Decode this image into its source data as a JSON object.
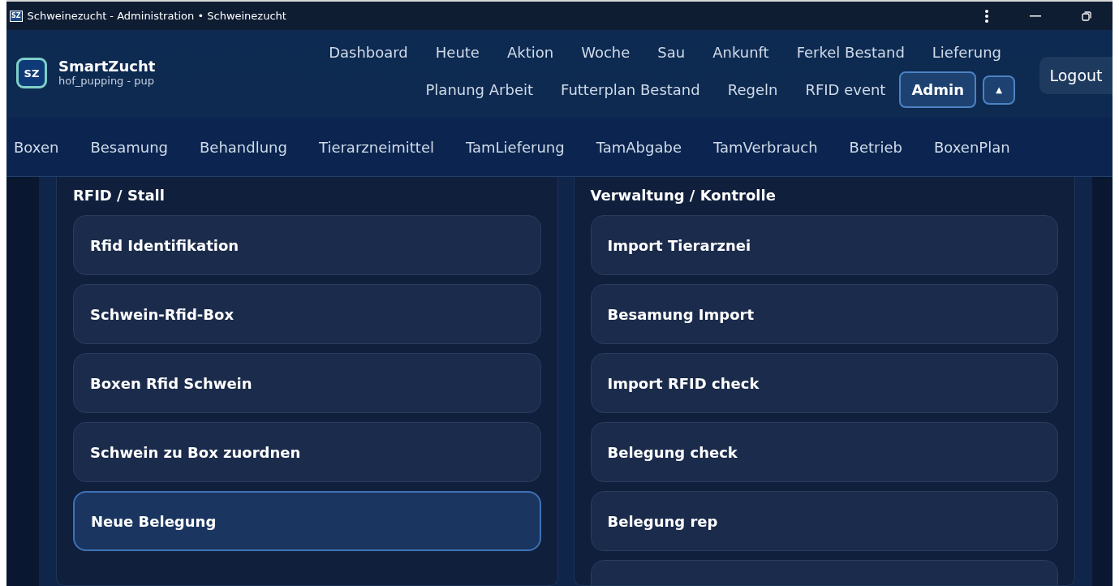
{
  "window": {
    "title": "Schweinezucht - Administration • Schweinezucht",
    "app_icon_text": "SZ"
  },
  "brand": {
    "logo_text": "SZ",
    "name": "SmartZucht",
    "subtitle": "hof_pupping - pup"
  },
  "nav_row_1": [
    {
      "label": "Dashboard",
      "selected": false
    },
    {
      "label": "Heute",
      "selected": false
    },
    {
      "label": "Aktion",
      "selected": false
    },
    {
      "label": "Woche",
      "selected": false
    },
    {
      "label": "Sau",
      "selected": false
    },
    {
      "label": "Ankunft",
      "selected": false
    },
    {
      "label": "Ferkel Bestand",
      "selected": false
    },
    {
      "label": "Lieferung",
      "selected": false
    }
  ],
  "nav_row_2": [
    {
      "label": "Planung Arbeit",
      "selected": false
    },
    {
      "label": "Futterplan Bestand",
      "selected": false
    },
    {
      "label": "Regeln",
      "selected": false
    },
    {
      "label": "RFID event",
      "selected": false
    },
    {
      "label": "Admin",
      "selected": true
    }
  ],
  "collapse_button": "▲",
  "logout": "Logout",
  "subnav": [
    "Boxen",
    "Besamung",
    "Behandlung",
    "Tierarzneimittel",
    "TamLieferung",
    "TamAbgabe",
    "TamVerbrauch",
    "Betrieb",
    "BoxenPlan"
  ],
  "sections": [
    {
      "title": "RFID / Stall",
      "items": [
        {
          "label": "Rfid Identifikation",
          "selected": false
        },
        {
          "label": "Schwein-Rfid-Box",
          "selected": false
        },
        {
          "label": "Boxen Rfid Schwein",
          "selected": false
        },
        {
          "label": "Schwein zu Box zuordnen",
          "selected": false
        },
        {
          "label": "Neue Belegung",
          "selected": true
        }
      ]
    },
    {
      "title": "Verwaltung / Kontrolle",
      "items": [
        {
          "label": "Import Tierarznei",
          "selected": false
        },
        {
          "label": "Besamung Import",
          "selected": false
        },
        {
          "label": "Import RFID check",
          "selected": false
        },
        {
          "label": "Belegung check",
          "selected": false
        },
        {
          "label": "Belegung rep",
          "selected": false
        }
      ]
    }
  ]
}
